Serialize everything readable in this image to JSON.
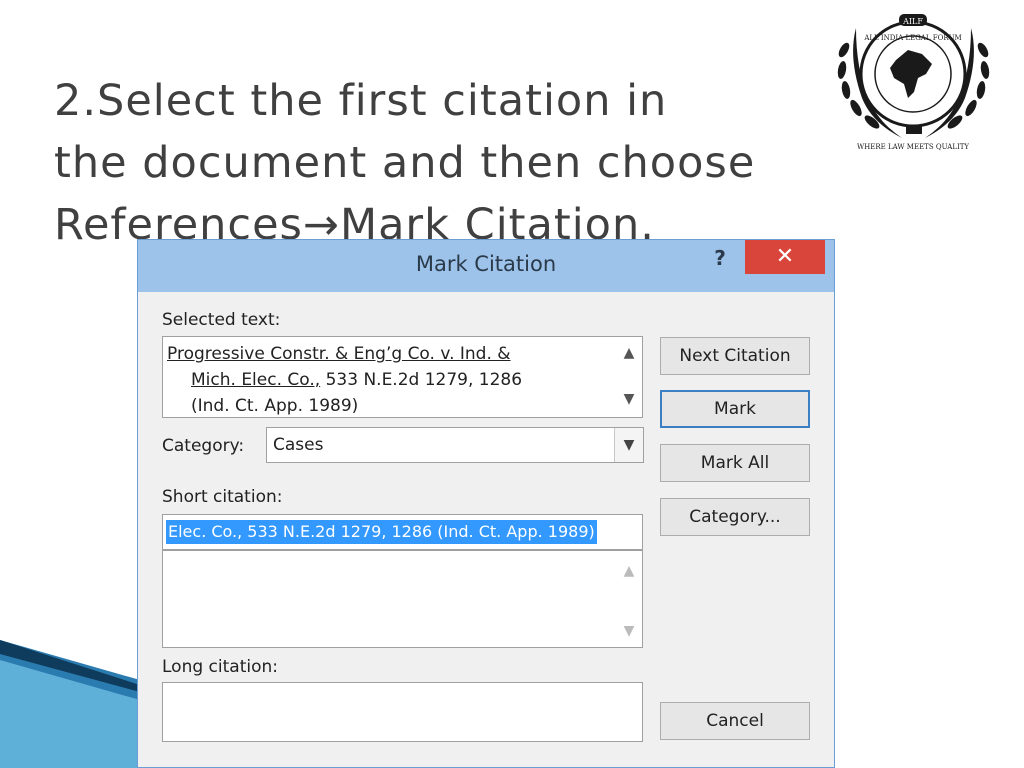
{
  "slide": {
    "title_lines": [
      "2.Select the first citation in",
      "the document and then choose",
      "References→Mark Citation."
    ]
  },
  "logo": {
    "text_top": "ALL INDIA LEGAL FORUM",
    "badge": "AILF",
    "tagline": "WHERE LAW MEETS QUALITY"
  },
  "dialog": {
    "title": "Mark Citation",
    "help_label": "?",
    "close_label": "✕",
    "selected_text_label": "Selected text:",
    "selected_text_lines": [
      "Progressive Constr. & Eng’g Co. v. Ind. &",
      "Mich. Elec. Co.,",
      " 533 N.E.2d 1279, 1286",
      "(Ind. Ct. App. 1989)"
    ],
    "category_label": "Category:",
    "category_value": "Cases",
    "short_citation_label": "Short citation:",
    "short_citation_value": "Elec. Co.,  533 N.E.2d 1279, 1286 (Ind. Ct. App. 1989)",
    "long_citation_label": "Long citation:",
    "buttons": {
      "next_citation": "Next Citation",
      "mark": "Mark",
      "mark_all": "Mark All",
      "category": "Category...",
      "cancel": "Cancel"
    }
  },
  "colors": {
    "titlebar": "#9dc3ea",
    "close": "#d9453a",
    "selection": "#3399ff"
  }
}
